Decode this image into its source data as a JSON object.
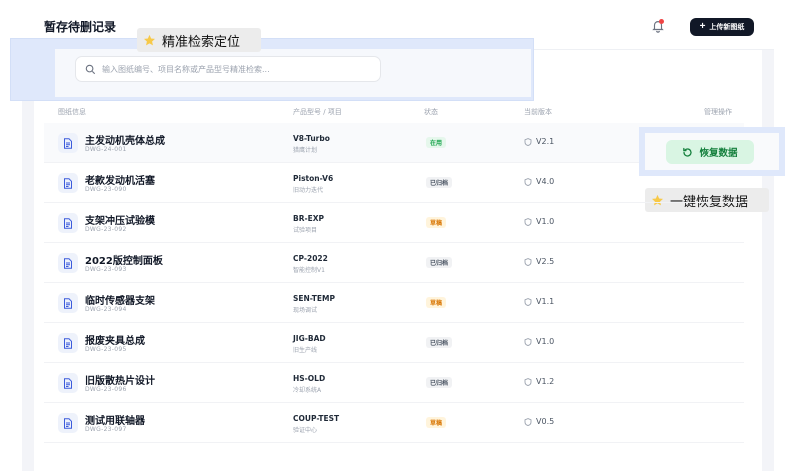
{
  "header": {
    "title": "暂存待删记录",
    "upload_label": "上传新图纸"
  },
  "search": {
    "placeholder": "输入图纸编号、项目名称或产品型号精准检索..."
  },
  "tips": {
    "search_tip": "精准检索定位",
    "restore_tip": "一键恢复数据"
  },
  "table": {
    "columns": [
      "图纸信息",
      "产品型号 / 项目",
      "状态",
      "当前版本",
      "管理操作"
    ],
    "restore_label": "恢复数据",
    "rows": [
      {
        "name": "主发动机壳体总成",
        "code": "DWG-24-001",
        "model": "V8-Turbo",
        "project": "猎鹰计划",
        "status": "在用",
        "status_color": "green",
        "version": "V2.1"
      },
      {
        "name": "老款发动机活塞",
        "code": "DWG-23-090",
        "model": "Piston-V6",
        "project": "旧动力迭代",
        "status": "已归档",
        "status_color": "gray",
        "version": "V4.0"
      },
      {
        "name": "支架冲压试验模",
        "code": "DWG-23-092",
        "model": "BR-EXP",
        "project": "试验项目",
        "status": "草稿",
        "status_color": "amber",
        "version": "V1.0"
      },
      {
        "name": "2022版控制面板",
        "code": "DWG-23-093",
        "model": "CP-2022",
        "project": "智能控制V1",
        "status": "已归档",
        "status_color": "gray",
        "version": "V2.5"
      },
      {
        "name": "临时传感器支架",
        "code": "DWG-23-094",
        "model": "SEN-TEMP",
        "project": "现场调试",
        "status": "草稿",
        "status_color": "amber",
        "version": "V1.1"
      },
      {
        "name": "报废夹具总成",
        "code": "DWG-23-095",
        "model": "JIG-BAD",
        "project": "旧生产线",
        "status": "已归档",
        "status_color": "gray",
        "version": "V1.0"
      },
      {
        "name": "旧版散热片设计",
        "code": "DWG-23-096",
        "model": "HS-OLD",
        "project": "冷却系统A",
        "status": "已归档",
        "status_color": "gray",
        "version": "V1.2"
      },
      {
        "name": "测试用联轴器",
        "code": "DWG-23-097",
        "model": "COUP-TEST",
        "project": "验证中心",
        "status": "草稿",
        "status_color": "amber",
        "version": "V0.5"
      }
    ]
  },
  "colors": {
    "primary_dark": "#111827",
    "success": "#16a34a",
    "warning": "#d97706",
    "highlight": "#dfe8fb"
  }
}
